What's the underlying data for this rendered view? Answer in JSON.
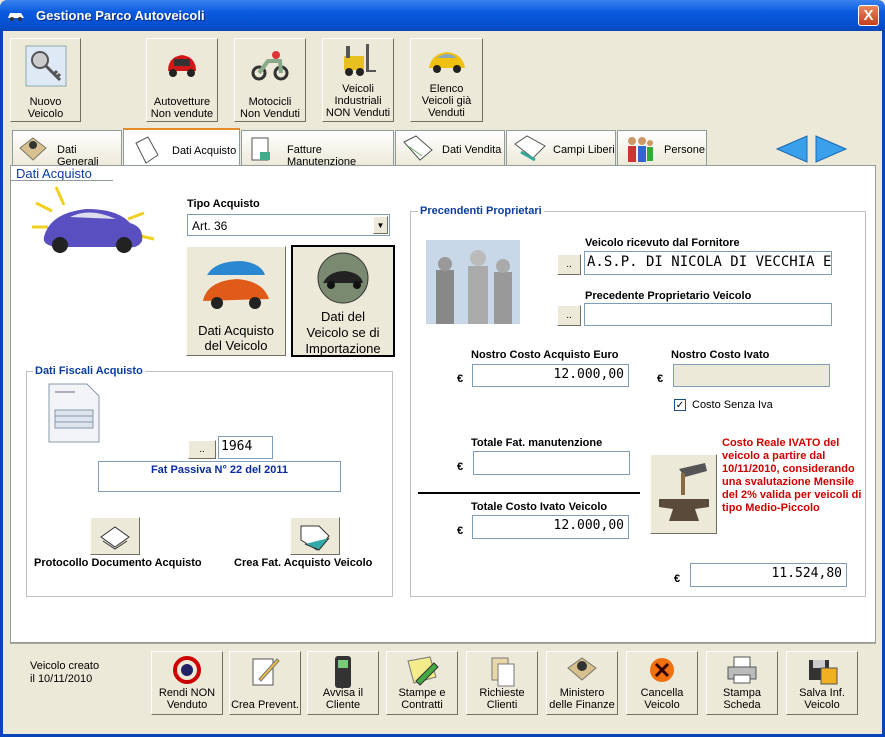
{
  "window": {
    "title": "Gestione Parco Autoveicoli",
    "close": "X"
  },
  "toolbar": [
    {
      "id": "nuovo",
      "label1": "Nuovo",
      "label2": "Veicolo"
    },
    {
      "id": "autovetture",
      "label1": "Autovetture",
      "label2": "Non vendute"
    },
    {
      "id": "motocicli",
      "label1": "Motocicli",
      "label2": "Non Venduti"
    },
    {
      "id": "industriali",
      "label1": "Veicoli",
      "label2": "Industriali",
      "label3": "NON Venduti"
    },
    {
      "id": "elenco",
      "label1": "Elenco",
      "label2": "Veicoli già",
      "label3": "Venduti"
    }
  ],
  "tabs": [
    "Dati Generali",
    "Dati Acquisto",
    "Fatture Manutenzione",
    "Dati Vendita",
    "Campi Liberi",
    "Persone"
  ],
  "panel_title": "Dati Acquisto",
  "tipo_acquisto": {
    "label": "Tipo Acquisto",
    "value": "Art. 36"
  },
  "btn_dati_acquisto": {
    "l1": "Dati Acquisto",
    "l2": "del Veicolo"
  },
  "btn_importazione": {
    "l1": "Dati del",
    "l2": "Veicolo se di",
    "l3": "Importazione"
  },
  "fiscali": {
    "legend": "Dati Fiscali Acquisto",
    "dots": "..",
    "numero": "1964",
    "fattura": "Fat Passiva  N° 22 del 2011",
    "protocollo": "Protocollo Documento Acquisto",
    "crea_fat": "Crea Fat. Acquisto Veicolo"
  },
  "proprietari": {
    "legend": "Precendenti Proprietari",
    "ricevuto_label": "Veicolo ricevuto dal Fornitore",
    "ricevuto_value": "A.S.P. DI NICOLA DI VECCHIA E",
    "precedente_label": "Precedente Proprietario Veicolo",
    "precedente_value": "",
    "dots": ".."
  },
  "costi": {
    "currency": "€",
    "nostro_costo_label": "Nostro Costo Acquisto Euro",
    "nostro_costo_value": "12.000,00",
    "ivato_label": "Nostro Costo Ivato",
    "ivato_value": "",
    "senza_iva_label": "Costo Senza Iva",
    "senza_iva_checked": "✓",
    "manut_label": "Totale Fat. manutenzione",
    "manut_value": "",
    "totale_label": "Totale Costo Ivato Veicolo",
    "totale_value": "12.000,00",
    "reale_note": "Costo Reale IVATO del veicolo a partire dal 10/11/2010, considerando una svalutazione Mensile del 2%  valida per veicoli di tipo Medio-Piccolo",
    "reale_value": "11.524,80"
  },
  "footer": {
    "created_l1": "Veicolo creato",
    "created_l2": "il 10/11/2010",
    "buttons": [
      {
        "l1": "Rendi NON",
        "l2": "Venduto"
      },
      {
        "l1": "",
        "l2": "Crea Prevent."
      },
      {
        "l1": "Avvisa il",
        "l2": "Cliente"
      },
      {
        "l1": "Stampe e",
        "l2": "Contratti"
      },
      {
        "l1": "Richieste",
        "l2": "Clienti"
      },
      {
        "l1": "Ministero",
        "l2": "delle Finanze"
      },
      {
        "l1": "Cancella",
        "l2": "Veicolo"
      },
      {
        "l1": "Stampa",
        "l2": "Scheda"
      },
      {
        "l1": "Salva Inf.",
        "l2": "Veicolo"
      }
    ]
  }
}
